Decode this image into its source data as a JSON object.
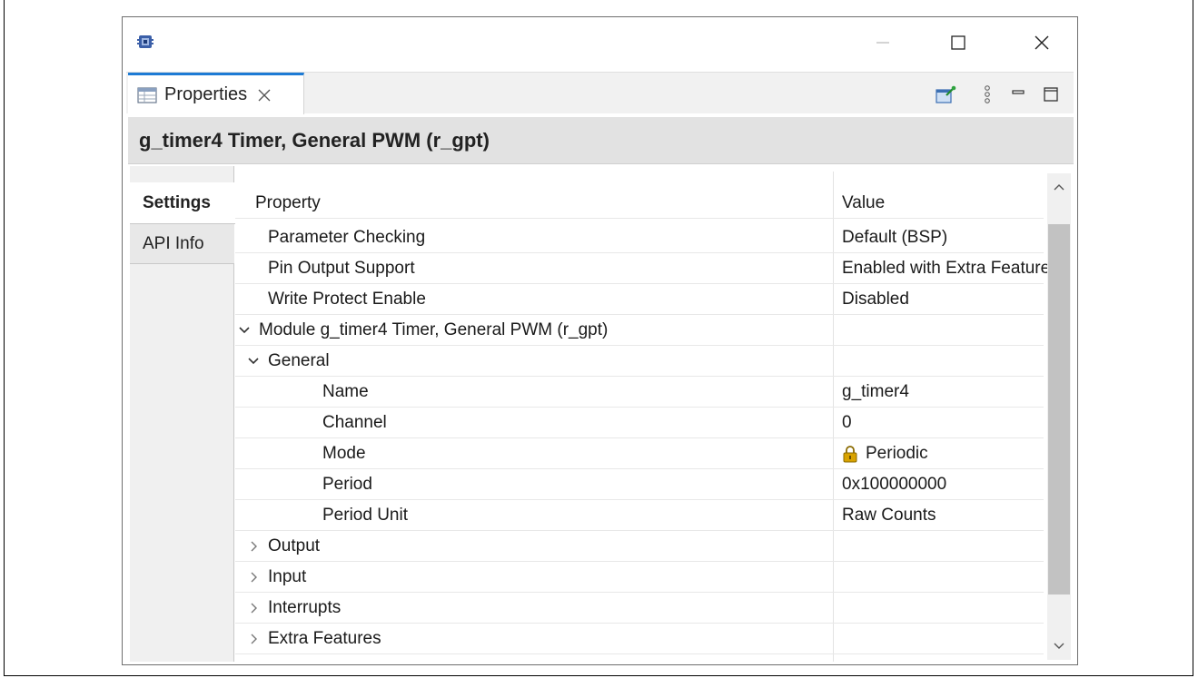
{
  "tab": {
    "label": "Properties"
  },
  "header": {
    "title": "g_timer4 Timer, General PWM (r_gpt)"
  },
  "side_tabs": [
    {
      "label": "Settings",
      "active": true
    },
    {
      "label": "API Info",
      "active": false
    }
  ],
  "columns": {
    "property": "Property",
    "value": "Value"
  },
  "rows": [
    {
      "property": "Parameter Checking",
      "value": "Default (BSP)",
      "indent": 1,
      "chevron": "none"
    },
    {
      "property": "Pin Output Support",
      "value": "Enabled with Extra Features",
      "indent": 1,
      "chevron": "none"
    },
    {
      "property": "Write Protect Enable",
      "value": "Disabled",
      "indent": 1,
      "chevron": "none"
    },
    {
      "property": "Module g_timer4 Timer, General PWM (r_gpt)",
      "value": "",
      "indent": 0,
      "chevron": "expanded"
    },
    {
      "property": "General",
      "value": "",
      "indent": 1,
      "chevron": "expanded"
    },
    {
      "property": "Name",
      "value": "g_timer4",
      "indent": 2,
      "chevron": "none"
    },
    {
      "property": "Channel",
      "value": "0",
      "indent": 2,
      "chevron": "none"
    },
    {
      "property": "Mode",
      "value": "Periodic",
      "indent": 2,
      "chevron": "none",
      "locked": true
    },
    {
      "property": "Period",
      "value": "0x100000000",
      "indent": 2,
      "chevron": "none"
    },
    {
      "property": "Period Unit",
      "value": "Raw Counts",
      "indent": 2,
      "chevron": "none"
    },
    {
      "property": "Output",
      "value": "",
      "indent": 1,
      "chevron": "collapsed"
    },
    {
      "property": "Input",
      "value": "",
      "indent": 1,
      "chevron": "collapsed"
    },
    {
      "property": "Interrupts",
      "value": "",
      "indent": 1,
      "chevron": "collapsed"
    },
    {
      "property": "Extra Features",
      "value": "",
      "indent": 1,
      "chevron": "collapsed"
    }
  ],
  "colors": {
    "tab_accent": "#1d7bd5",
    "header_bg": "#e2e2e2",
    "lock": "#d9a300"
  },
  "icons": {
    "app": "chip-icon",
    "close_tab": "close-icon",
    "pin": "pin-to-view-icon",
    "menu": "view-menu-icon",
    "minimize": "minimize-icon",
    "maximize": "maximize-icon",
    "lock": "lock-icon",
    "expand": "chevron-down-icon",
    "collapse": "chevron-right-icon"
  }
}
